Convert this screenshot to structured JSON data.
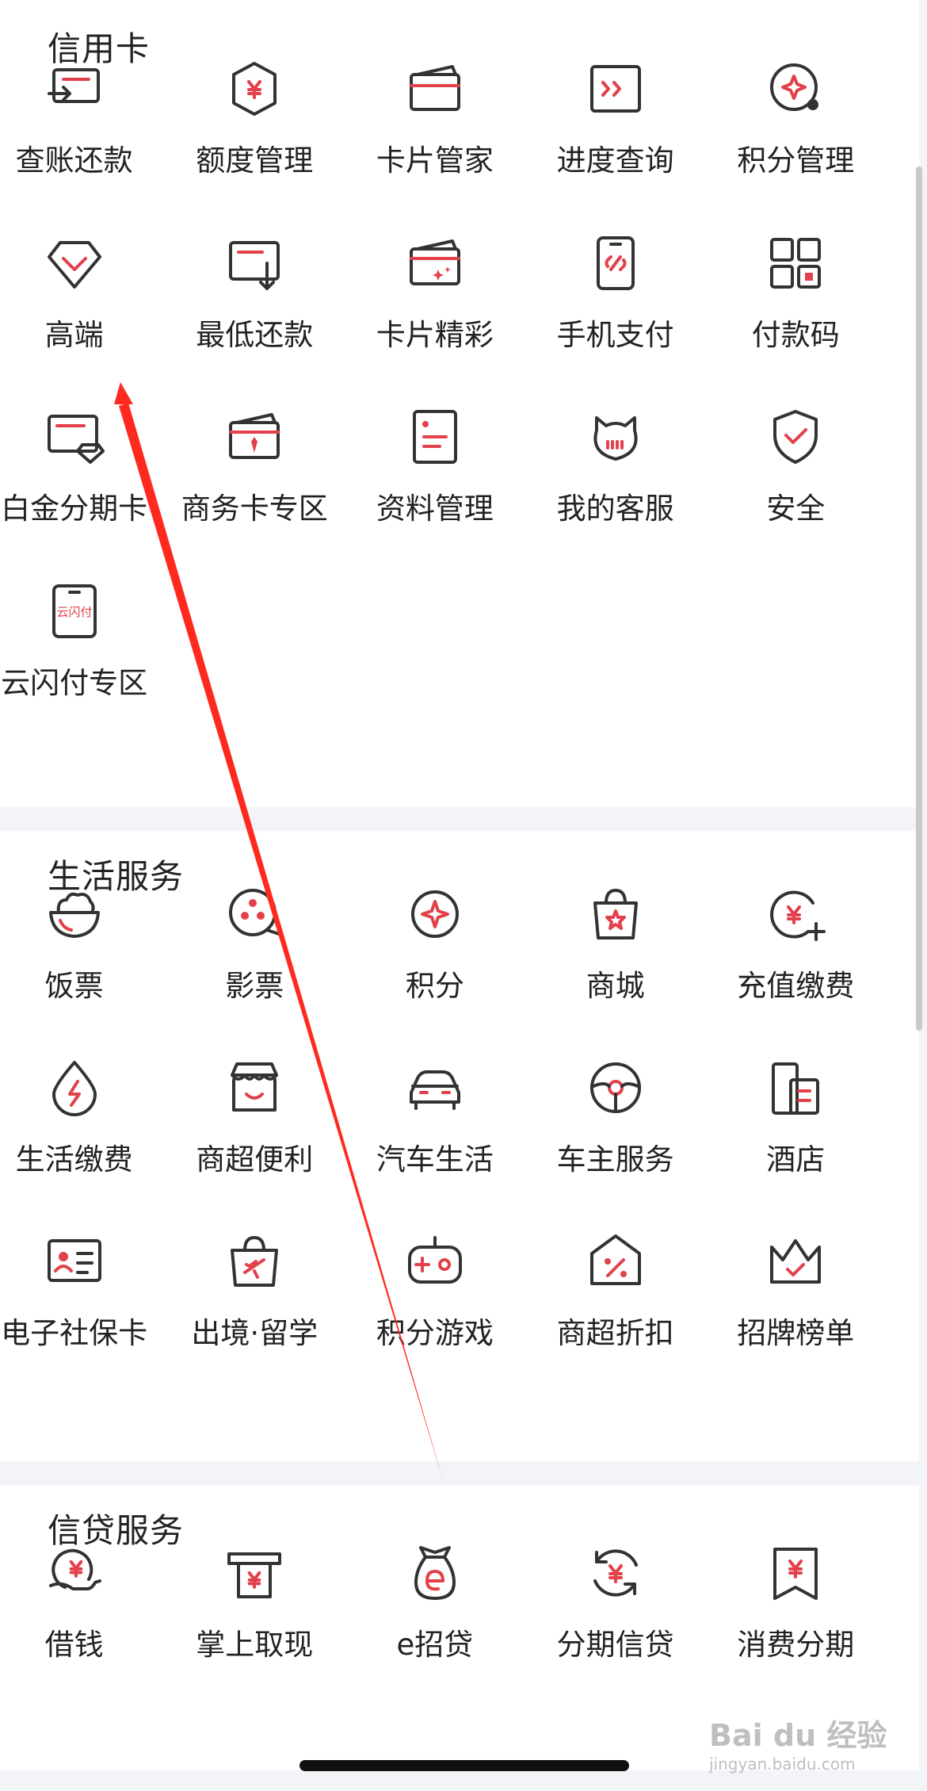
{
  "sections": [
    {
      "title": "信用卡",
      "items": [
        {
          "label": "查账还款",
          "icon": "bill-repay-icon"
        },
        {
          "label": "额度管理",
          "icon": "credit-limit-icon"
        },
        {
          "label": "卡片管家",
          "icon": "card-wallet-icon"
        },
        {
          "label": "进度查询",
          "icon": "progress-query-icon"
        },
        {
          "label": "积分管理",
          "icon": "points-manage-icon"
        },
        {
          "label": "高端",
          "icon": "diamond-icon"
        },
        {
          "label": "最低还款",
          "icon": "min-repay-icon"
        },
        {
          "label": "卡片精彩",
          "icon": "card-sparkle-icon"
        },
        {
          "label": "手机支付",
          "icon": "phone-pay-icon"
        },
        {
          "label": "付款码",
          "icon": "qr-code-icon"
        },
        {
          "label": "白金分期卡",
          "icon": "platinum-card-icon"
        },
        {
          "label": "商务卡专区",
          "icon": "business-card-icon"
        },
        {
          "label": "资料管理",
          "icon": "document-icon"
        },
        {
          "label": "我的客服",
          "icon": "customer-service-icon"
        },
        {
          "label": "安全",
          "icon": "shield-check-icon"
        },
        {
          "label": "云闪付专区",
          "icon": "cloud-quickpass-icon"
        }
      ]
    },
    {
      "title": "生活服务",
      "items": [
        {
          "label": "饭票",
          "icon": "rice-bowl-icon"
        },
        {
          "label": "影票",
          "icon": "film-reel-icon"
        },
        {
          "label": "积分",
          "icon": "points-star-icon"
        },
        {
          "label": "商城",
          "icon": "shopping-bag-icon"
        },
        {
          "label": "充值缴费",
          "icon": "recharge-icon"
        },
        {
          "label": "生活缴费",
          "icon": "utility-drop-icon"
        },
        {
          "label": "商超便利",
          "icon": "store-icon"
        },
        {
          "label": "汽车生活",
          "icon": "car-icon"
        },
        {
          "label": "车主服务",
          "icon": "steering-wheel-icon"
        },
        {
          "label": "酒店",
          "icon": "hotel-icon"
        },
        {
          "label": "电子社保卡",
          "icon": "id-card-icon"
        },
        {
          "label": "出境·留学",
          "icon": "travel-bag-icon"
        },
        {
          "label": "积分游戏",
          "icon": "gamepad-icon"
        },
        {
          "label": "商超折扣",
          "icon": "discount-tag-icon"
        },
        {
          "label": "招牌榜单",
          "icon": "crown-icon"
        }
      ]
    },
    {
      "title": "信贷服务",
      "items": [
        {
          "label": "借钱",
          "icon": "borrow-money-icon"
        },
        {
          "label": "掌上取现",
          "icon": "atm-cash-icon"
        },
        {
          "label": "e招贷",
          "icon": "money-bag-icon"
        },
        {
          "label": "分期信贷",
          "icon": "installment-icon"
        },
        {
          "label": "消费分期",
          "icon": "consume-installment-icon"
        }
      ]
    }
  ],
  "watermark": {
    "line1": "Bai du 经验",
    "line2": "jingyan.baidu.com"
  },
  "colors": {
    "accent": "#e2404a",
    "icon_stroke": "#333333",
    "annotation": "#ff2a1f"
  }
}
